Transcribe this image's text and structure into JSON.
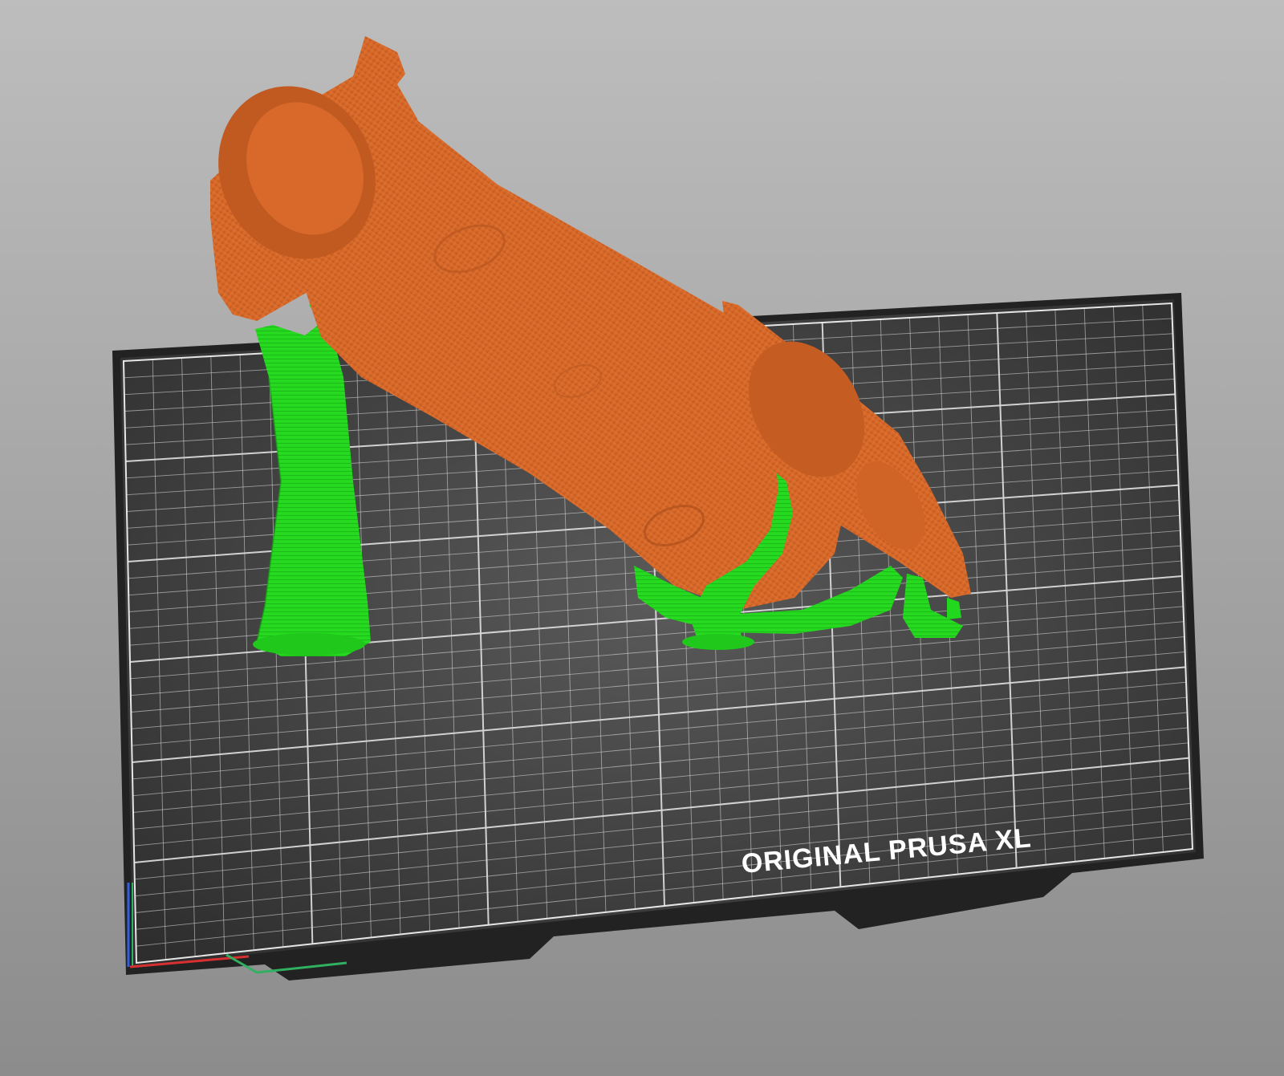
{
  "app": {
    "view": "3D plater (slice preview)"
  },
  "bed": {
    "label": "ORIGINAL PRUSA XL",
    "color": "#3a3a3a",
    "grid_color": "#d9d9d9"
  },
  "scene": {
    "background_top": "#b9b9b9",
    "background_bottom": "#8a8a8a",
    "model_color": "#e0702e",
    "support_color": "#22d81e"
  },
  "axes": {
    "x_color": "#d83030",
    "y_color": "#30b060",
    "z_color": "#3060e0"
  }
}
